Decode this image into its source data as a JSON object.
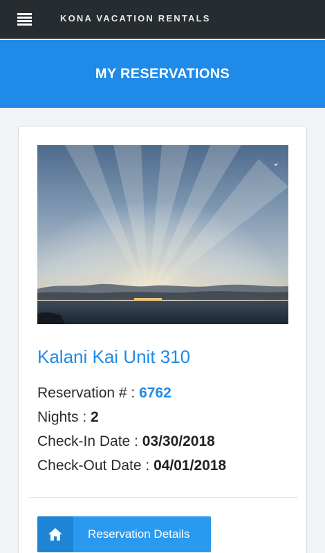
{
  "header": {
    "brand": "KONA VACATION RENTALS",
    "menu_icon": "hamburger-menu-icon"
  },
  "page": {
    "title": "MY RESERVATIONS"
  },
  "reservation": {
    "photo_description_icon": "sunset-ocean-photo",
    "unit_name": "Kalani Kai Unit 310",
    "reservation_label": "Reservation # : ",
    "reservation_number": "6762",
    "nights_label": "Nights : ",
    "nights": "2",
    "checkin_label": "Check-In Date : ",
    "checkin_date": "03/30/2018",
    "checkout_label": "Check-Out Date : ",
    "checkout_date": "04/01/2018",
    "details_button_label": "Reservation Details",
    "details_button_icon": "home-icon"
  },
  "colors": {
    "topbar": "#262c2f",
    "accent": "#1f8ae8",
    "button": "#2a99f0",
    "button_icon_bg": "#1e84d6"
  }
}
